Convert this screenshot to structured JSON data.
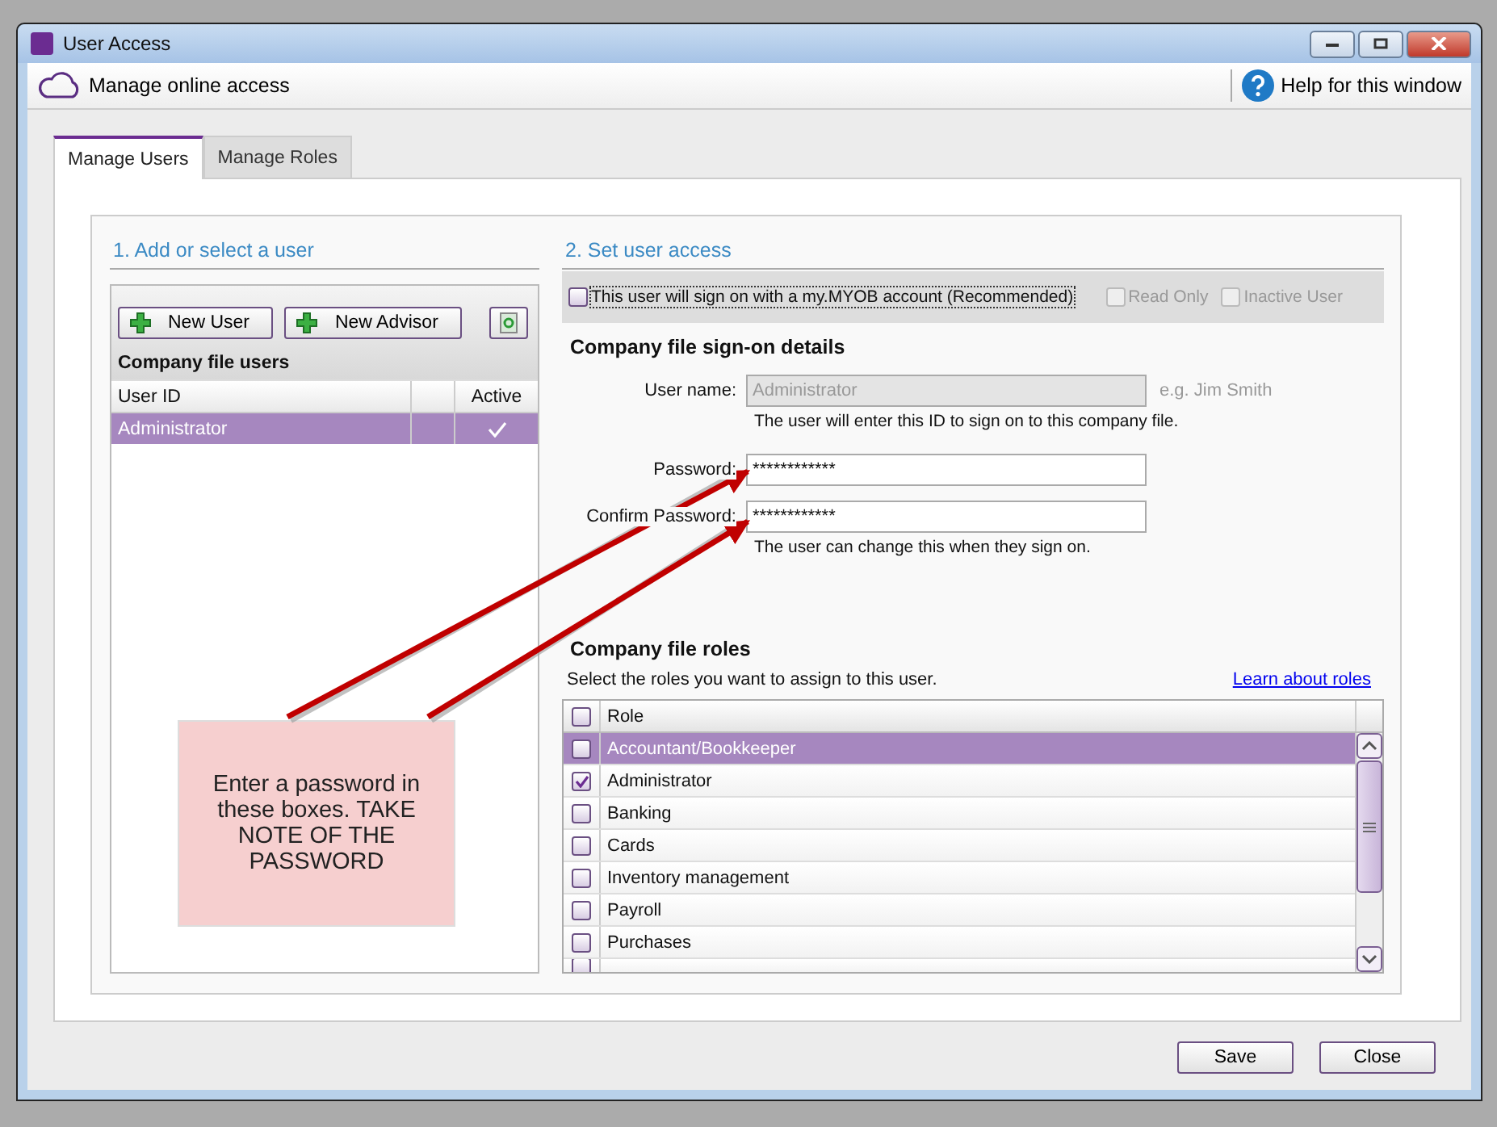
{
  "window": {
    "title": "User Access"
  },
  "toolbar": {
    "online_access": "Manage online access",
    "help": "Help for this window"
  },
  "tabs": [
    {
      "label": "Manage Users",
      "selected": true
    },
    {
      "label": "Manage Roles",
      "selected": false
    }
  ],
  "users": {
    "heading": "1. Add or select a user",
    "buttons": [
      "New User",
      "New Advisor"
    ],
    "title": "Company file users",
    "columns": [
      "User ID",
      "Active"
    ],
    "rows": [
      {
        "user_id": "Administrator",
        "active": true,
        "selected": true
      }
    ]
  },
  "access": {
    "heading": "2. Set user access",
    "options": [
      {
        "label": "This user will sign on with a my.MYOB account (Recommended)",
        "checked": false,
        "disabled": false
      },
      {
        "label": "Read Only",
        "checked": false,
        "disabled": true
      },
      {
        "label": "Inactive User",
        "checked": false,
        "disabled": true
      }
    ],
    "sign_on_title": "Company file sign-on details",
    "user_name": {
      "label": "User name:",
      "value": "Administrator",
      "disabled": true,
      "placeholder": "e.g. Jim Smith",
      "note": "The user will enter this ID to sign on to this company file."
    },
    "password": {
      "label": "Password:",
      "value": "************"
    },
    "confirm": {
      "label": "Confirm Password:",
      "value": "************",
      "note": "The user can change this when they sign on."
    },
    "roles_title": "Company file roles",
    "roles_instruction": "Select the roles you want to assign to this user.",
    "roles_link": "Learn about roles",
    "roles_column": "Role",
    "roles_all_checked": false,
    "partial_row": {
      "checked": false
    },
    "roles": [
      {
        "name": "Accountant/Bookkeeper",
        "checked": false,
        "selected": true
      },
      {
        "name": "Administrator",
        "checked": true,
        "selected": false
      },
      {
        "name": "Banking",
        "checked": false,
        "selected": false
      },
      {
        "name": "Cards",
        "checked": false,
        "selected": false
      },
      {
        "name": "Inventory management",
        "checked": false,
        "selected": false
      },
      {
        "name": "Payroll",
        "checked": false,
        "selected": false
      },
      {
        "name": "Purchases",
        "checked": false,
        "selected": false
      }
    ]
  },
  "callout": "Enter a password in these boxes. TAKE NOTE OF THE PASSWORD",
  "buttons": [
    "Save",
    "Close"
  ]
}
